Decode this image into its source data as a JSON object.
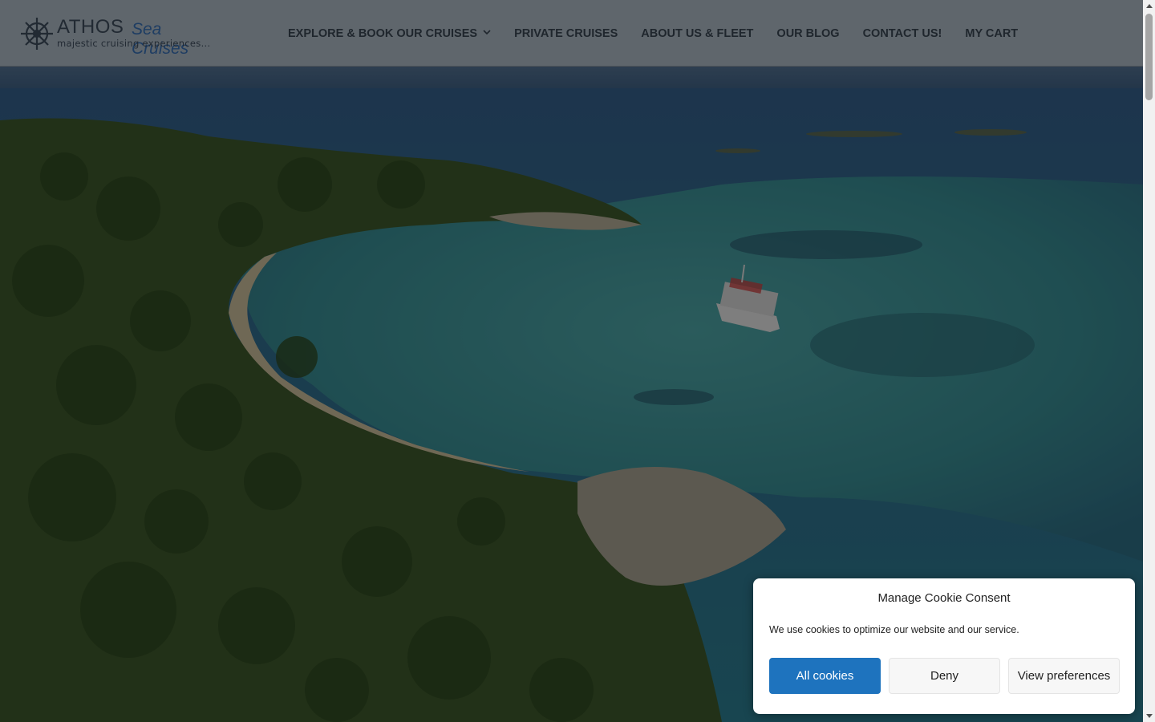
{
  "brand": {
    "name": "ATHOS",
    "name_suffix": "Sea Cruises",
    "tagline": "majestic cruising experiences..."
  },
  "nav": {
    "items": [
      {
        "label": "EXPLORE & BOOK OUR CRUISES",
        "has_dropdown": true
      },
      {
        "label": "PRIVATE CRUISES"
      },
      {
        "label": "ABOUT US & FLEET"
      },
      {
        "label": "OUR BLOG"
      },
      {
        "label": "CONTACT US!"
      },
      {
        "label": "MY CART"
      }
    ]
  },
  "cookie_consent": {
    "title": "Manage Cookie Consent",
    "message": "We use cookies to optimize our website and our service.",
    "buttons": {
      "accept": "All cookies",
      "deny": "Deny",
      "preferences": "View preferences"
    }
  },
  "colors": {
    "accent": "#1e73be",
    "header_bg": "#5f666c",
    "brand_dark": "#222a33",
    "brand_blue": "#1e3d63"
  }
}
